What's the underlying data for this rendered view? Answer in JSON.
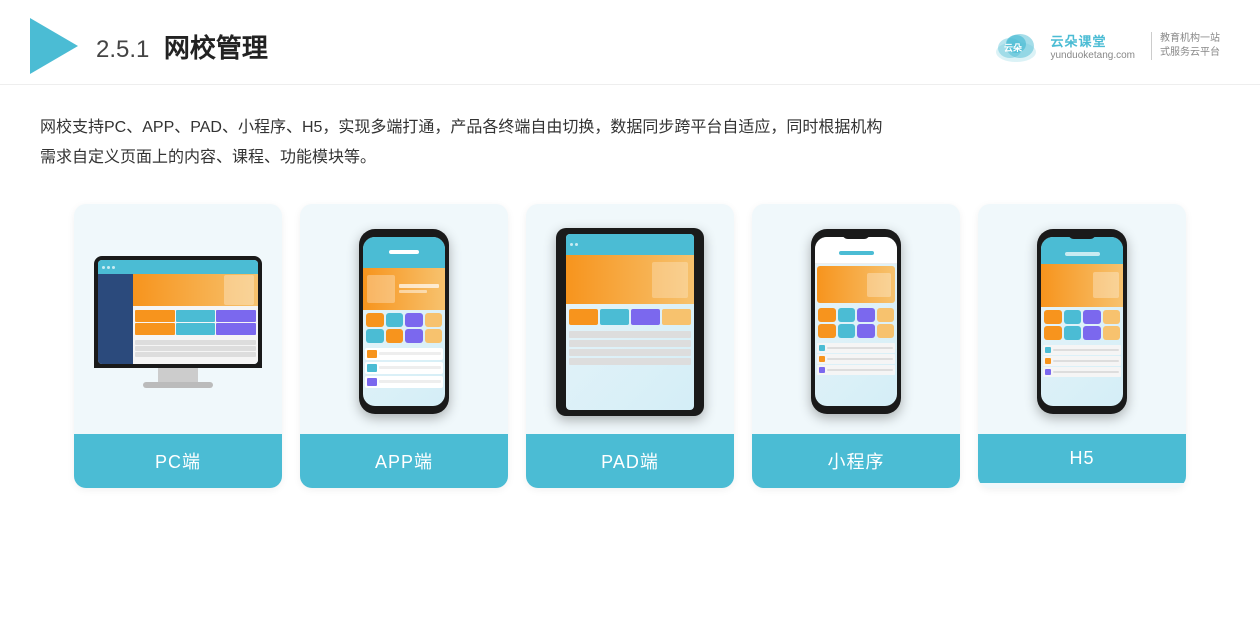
{
  "header": {
    "title": "网校管理",
    "number": "2.5.1",
    "logo": {
      "url": "yunduoketang.com",
      "name": "云朵课堂",
      "slogan": "教育机构一站\n式服务云平台"
    }
  },
  "description": {
    "line1": "网校支持PC、APP、PAD、小程序、H5，实现多端打通，产品各终端自由切换，数据同步跨平台自适应，同时根据机构",
    "line2": "需求自定义页面上的内容、课程、功能模块等。"
  },
  "cards": [
    {
      "id": "pc",
      "label": "PC端",
      "type": "monitor"
    },
    {
      "id": "app",
      "label": "APP端",
      "type": "phone"
    },
    {
      "id": "pad",
      "label": "PAD端",
      "type": "tablet"
    },
    {
      "id": "miniprogram",
      "label": "小程序",
      "type": "phone-notch"
    },
    {
      "id": "h5",
      "label": "H5",
      "type": "phone-notch"
    }
  ],
  "colors": {
    "teal": "#4BBCD4",
    "bg": "#f0f8fb",
    "dark": "#1a1a1a"
  }
}
